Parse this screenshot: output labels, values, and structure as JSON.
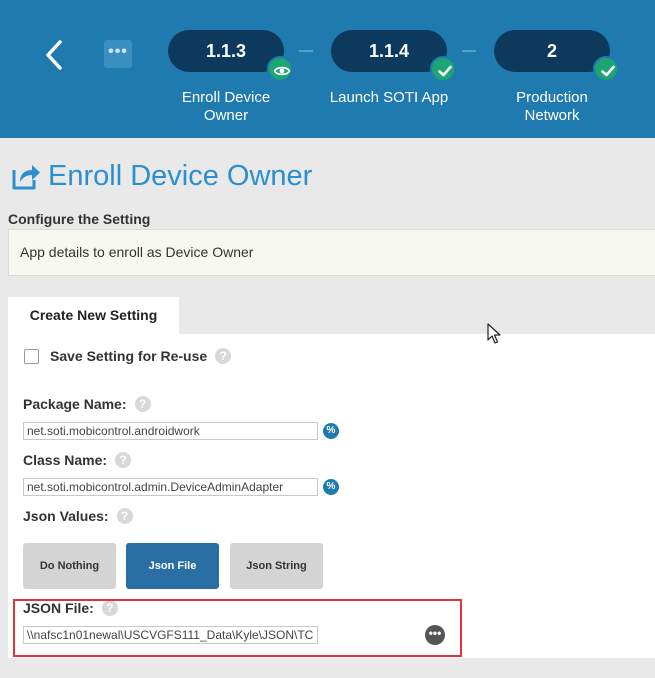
{
  "header": {
    "steps": [
      {
        "id": "1.1.3",
        "label_line1": "Enroll Device",
        "label_line2": "Owner",
        "status_icon": "eye-icon"
      },
      {
        "id": "1.1.4",
        "label_line1": "Launch SOTI App",
        "label_line2": "",
        "status_icon": "check-icon"
      },
      {
        "id": "2",
        "label_line1": "Production",
        "label_line2": "Network",
        "status_icon": "check-icon"
      }
    ],
    "more_label": "•••"
  },
  "page": {
    "title": "Enroll Device Owner",
    "title_icon": "share-icon",
    "configure_label": "Configure the Setting",
    "description": "App details to enroll as Device Owner"
  },
  "tabs": [
    {
      "label": "Create New Setting",
      "active": true
    }
  ],
  "form": {
    "save_setting_label": "Save Setting for Re-use",
    "save_setting_checked": false,
    "package_name_label": "Package Name:",
    "package_name_value": "net.soti.mobicontrol.androidwork",
    "class_name_label": "Class Name:",
    "class_name_value": "net.soti.mobicontrol.admin.DeviceAdminAdapter",
    "json_values_label": "Json Values:",
    "json_options": [
      "Do Nothing",
      "Json File",
      "Json String"
    ],
    "json_selected": "Json File",
    "json_file_label": "JSON File:",
    "json_file_value": "\\\\nafsc1n01newal\\USCVGFS111_Data\\Kyle\\JSON\\TC",
    "help_glyph": "?",
    "variable_glyph": "%",
    "browse_glyph": "•••"
  },
  "colors": {
    "header_bg": "#1f7aaf",
    "step_pill": "#0d3a5c",
    "status_green": "#1ea672",
    "title_blue": "#2c8fce",
    "active_button": "#2a6fa3",
    "highlight_red": "#e0343a"
  }
}
